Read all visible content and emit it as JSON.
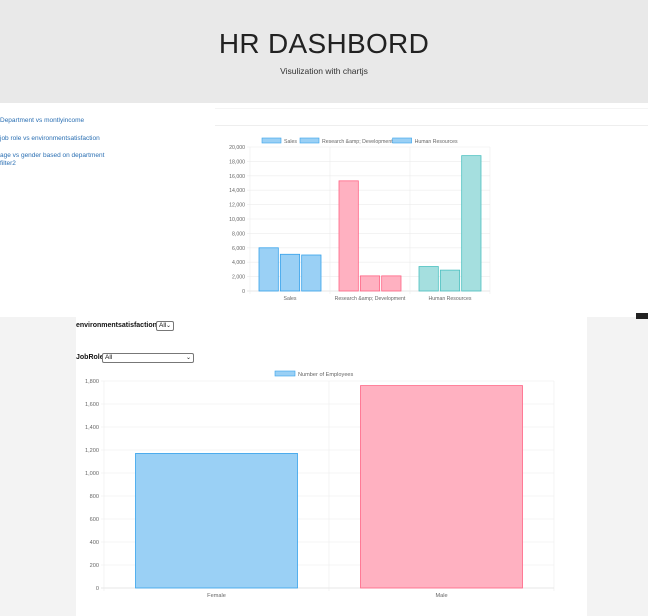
{
  "header": {
    "title": "HR DASHBORD",
    "subtitle": "Visulization with chartjs"
  },
  "sidebar": {
    "links": [
      "Department vs montlyincome",
      "job role vs environmentsatisfaction",
      "age vs gender based on department",
      "filter2"
    ]
  },
  "filters": {
    "env_label": "environmentsatisfaction",
    "env_value": "All",
    "jobrole_label": "JobRole",
    "jobrole_value": "All"
  },
  "colors": {
    "blue_fill": "#9ad0f5",
    "blue_border": "#36a2eb",
    "pink_fill": "#ffb1c1",
    "pink_border": "#ff6384",
    "teal_fill": "#a5dfdf",
    "teal_border": "#4bc0c0"
  },
  "chart_data": [
    {
      "type": "bar",
      "categories": [
        "Sales",
        "Research &amp; Development",
        "Human Resources"
      ],
      "series": [
        {
          "name": "Sales",
          "values": [
            6000,
            15300,
            3400
          ]
        },
        {
          "name": "Research &amp; Development",
          "values": [
            5100,
            2100,
            2900
          ]
        },
        {
          "name": "Human Resources",
          "values": [
            5000,
            2100,
            18800
          ]
        }
      ],
      "bar_colors": [
        "blue",
        "pink",
        "teal"
      ],
      "ylim": [
        0,
        20000
      ],
      "yticks": [
        "0",
        "2,000",
        "4,000",
        "6,000",
        "8,000",
        "10,000",
        "12,000",
        "14,000",
        "16,000",
        "18,000",
        "20,000"
      ],
      "legend": "top"
    },
    {
      "type": "bar",
      "categories": [
        "Female",
        "Male"
      ],
      "series": [
        {
          "name": "Number of Employees",
          "values": [
            1170,
            1760
          ]
        }
      ],
      "bar_colors": [
        "blue",
        "pink"
      ],
      "ylim": [
        0,
        1800
      ],
      "yticks": [
        "0",
        "200",
        "400",
        "600",
        "800",
        "1,000",
        "1,200",
        "1,400",
        "1,600",
        "1,800"
      ],
      "legend": "top"
    }
  ]
}
